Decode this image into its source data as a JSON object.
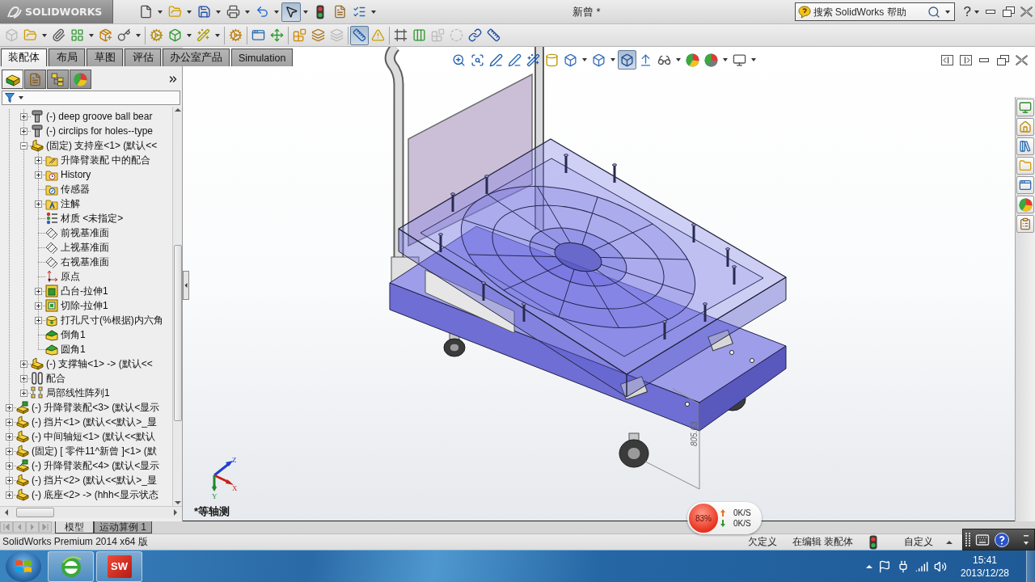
{
  "window": {
    "logo": "SOLIDWORKS",
    "title": "新曾 *",
    "help_button": "?"
  },
  "quick_access": [
    {
      "kind": "new",
      "dropdown": true,
      "pressed": false
    },
    {
      "kind": "open",
      "dropdown": true,
      "pressed": false
    },
    {
      "kind": "save",
      "dropdown": true,
      "pressed": false
    },
    {
      "kind": "print",
      "dropdown": true,
      "pressed": false
    },
    {
      "kind": "undo",
      "dropdown": true,
      "pressed": false
    },
    {
      "kind": "select",
      "dropdown": true,
      "pressed": true
    },
    {
      "kind": "rebuild",
      "dropdown": false,
      "pressed": false
    },
    {
      "kind": "file_properties",
      "dropdown": false,
      "pressed": false
    },
    {
      "kind": "options",
      "dropdown": true,
      "pressed": false
    }
  ],
  "help_search": {
    "placeholder": "搜索 SolidWorks 帮助"
  },
  "command_toolbar": [
    [
      {
        "kind": "edit_component",
        "dropdown": false,
        "pressed": false,
        "disabled": true
      },
      {
        "kind": "insert_components",
        "dropdown": true,
        "pressed": false,
        "disabled": false
      },
      {
        "kind": "mate",
        "dropdown": false,
        "pressed": false,
        "disabled": false
      },
      {
        "kind": "linear_pattern",
        "dropdown": true,
        "pressed": false,
        "disabled": false
      },
      {
        "kind": "smart_fasteners",
        "dropdown": false,
        "pressed": false,
        "disabled": false
      },
      {
        "kind": "move_component",
        "dropdown": true,
        "pressed": false,
        "disabled": false
      }
    ],
    [
      {
        "kind": "show_hidden",
        "dropdown": false,
        "pressed": false,
        "disabled": false
      },
      {
        "kind": "assembly_features",
        "dropdown": true,
        "pressed": false,
        "disabled": false
      },
      {
        "kind": "reference_geometry",
        "dropdown": true,
        "pressed": false,
        "disabled": false
      }
    ],
    [
      {
        "kind": "new_motion_study",
        "dropdown": false,
        "pressed": false,
        "disabled": false
      }
    ],
    [
      {
        "kind": "bill_of_materials",
        "dropdown": false,
        "pressed": false,
        "disabled": false
      },
      {
        "kind": "exploded_view",
        "dropdown": false,
        "pressed": false,
        "disabled": false
      }
    ],
    [
      {
        "kind": "explode_line_sketch",
        "dropdown": false,
        "pressed": false,
        "disabled": false
      },
      {
        "kind": "interference_detection",
        "dropdown": false,
        "pressed": false,
        "disabled": false
      },
      {
        "kind": "clearance_verification",
        "dropdown": false,
        "pressed": false,
        "disabled": true
      }
    ],
    [
      {
        "kind": "hole_alignment",
        "dropdown": false,
        "pressed": true,
        "disabled": false
      },
      {
        "kind": "compare_documents",
        "dropdown": false,
        "pressed": false,
        "disabled": false
      }
    ],
    [
      {
        "kind": "assembly_visualization",
        "dropdown": false,
        "pressed": false,
        "disabled": false
      },
      {
        "kind": "performance_evaluation",
        "dropdown": false,
        "pressed": false,
        "disabled": false
      },
      {
        "kind": "large_assembly_mode",
        "dropdown": false,
        "pressed": false,
        "disabled": true
      },
      {
        "kind": "speedpak",
        "dropdown": false,
        "pressed": false,
        "disabled": true
      },
      {
        "kind": "take_snapshot",
        "dropdown": false,
        "pressed": false,
        "disabled": false
      },
      {
        "kind": "large_design_review",
        "dropdown": false,
        "pressed": false,
        "disabled": false
      }
    ]
  ],
  "command_tabs": [
    {
      "label": "装配体",
      "selected": true
    },
    {
      "label": "布局",
      "selected": false
    },
    {
      "label": "草图",
      "selected": false
    },
    {
      "label": "评估",
      "selected": false
    },
    {
      "label": "办公室产品",
      "selected": false
    },
    {
      "label": "Simulation",
      "selected": false
    }
  ],
  "feature_manager": {
    "panel_tabs": [
      {
        "kind": "feature_tree",
        "selected": true
      },
      {
        "kind": "properties",
        "selected": false
      },
      {
        "kind": "configurations",
        "selected": false
      },
      {
        "kind": "display",
        "selected": false
      }
    ],
    "tree": {
      "continued_children": [
        {
          "label": "(-) deep groove ball bear",
          "kind": "toolbox_part",
          "expanded": false
        },
        {
          "label": "(-) circlips for holes--type",
          "kind": "toolbox_part",
          "expanded": false
        },
        {
          "label": "(固定) 支持座<1> (默认<<",
          "kind": "part",
          "expanded": true,
          "children": [
            {
              "label": "升降臂装配 中的配合",
              "kind": "mates_folder",
              "expanded": false
            },
            {
              "label": "History",
              "kind": "history",
              "expanded": false
            },
            {
              "label": "传感器",
              "kind": "sensors"
            },
            {
              "label": "注解",
              "kind": "annotations",
              "expanded": false
            },
            {
              "label": "材质 <未指定>",
              "kind": "material"
            },
            {
              "label": "前视基准面",
              "kind": "plane"
            },
            {
              "label": "上视基准面",
              "kind": "plane"
            },
            {
              "label": "右视基准面",
              "kind": "plane"
            },
            {
              "label": "原点",
              "kind": "origin"
            },
            {
              "label": "凸台-拉伸1",
              "kind": "boss",
              "expanded": false
            },
            {
              "label": "切除-拉伸1",
              "kind": "cut",
              "expanded": false
            },
            {
              "label": "打孔尺寸(%根据)内六角",
              "kind": "hole",
              "expanded": false
            },
            {
              "label": "倒角1",
              "kind": "chamfer"
            },
            {
              "label": "圆角1",
              "kind": "fillet"
            }
          ]
        },
        {
          "label": "(-) 支撑轴<1> -> (默认<<",
          "kind": "part",
          "expanded": false
        },
        {
          "label": "配合",
          "kind": "mates",
          "expanded": false
        },
        {
          "label": "局部线性阵列1",
          "kind": "pattern",
          "expanded": false
        }
      ],
      "items": [
        {
          "label": "(-) 升降臂装配<3> (默认<显示",
          "kind": "subassembly",
          "expanded": false
        },
        {
          "label": "(-) 挡片<1> (默认<<默认>_显",
          "kind": "part",
          "expanded": false
        },
        {
          "label": "(-) 中间轴短<1> (默认<<默认",
          "kind": "part",
          "expanded": false
        },
        {
          "label": "(固定) [ 零件11^新曾 ]<1> (默",
          "kind": "part",
          "expanded": false
        },
        {
          "label": "(-) 升降臂装配<4> (默认<显示",
          "kind": "subassembly",
          "expanded": false
        },
        {
          "label": "(-) 挡片<2> (默认<<默认>_显",
          "kind": "part",
          "expanded": false
        },
        {
          "label": "(-) 底座<2> -> (hhh<显示状态",
          "kind": "part",
          "expanded": false
        }
      ]
    }
  },
  "graphics_area": {
    "heads_up_toolbar": [
      {
        "kind": "zoom_fit",
        "dropdown": false,
        "pressed": false
      },
      {
        "kind": "zoom_area",
        "dropdown": false,
        "pressed": false
      },
      {
        "kind": "previous_view",
        "dropdown": false,
        "pressed": false
      },
      {
        "kind": "rotate_view",
        "dropdown": false,
        "pressed": false
      },
      {
        "kind": "dynamic_annotation",
        "dropdown": false,
        "pressed": false
      },
      {
        "kind": "section_view",
        "dropdown": false,
        "pressed": false
      },
      {
        "kind": "view_orientation",
        "dropdown": true,
        "pressed": false
      },
      {
        "kind": "display_style",
        "dropdown": true,
        "pressed": false
      },
      {
        "kind": "shaded",
        "dropdown": false,
        "pressed": true
      },
      {
        "kind": "hide_show",
        "dropdown": false,
        "pressed": false
      },
      {
        "kind": "hide_show_items",
        "dropdown": true,
        "pressed": false
      },
      {
        "kind": "edit_appearance",
        "dropdown": false,
        "pressed": false
      },
      {
        "kind": "apply_scene",
        "dropdown": true,
        "pressed": false
      },
      {
        "kind": "view_settings",
        "dropdown": true,
        "pressed": false
      }
    ],
    "dimension": "805.63",
    "view_label": "*等轴测",
    "triad": [
      {
        "kind": "z",
        "label": "Z"
      },
      {
        "kind": "x",
        "label": "X"
      },
      {
        "kind": "y",
        "label": "Y"
      }
    ]
  },
  "task_pane": [
    {
      "kind": "forum"
    },
    {
      "kind": "resources"
    },
    {
      "kind": "design_library"
    },
    {
      "kind": "file_explorer"
    },
    {
      "kind": "view_palette"
    },
    {
      "kind": "appearances"
    },
    {
      "kind": "custom_properties"
    }
  ],
  "bottom_tabs": [
    {
      "label": "模型",
      "selected": true
    },
    {
      "label": "运动算例 1",
      "selected": false
    }
  ],
  "status_bar": {
    "product": "SolidWorks Premium 2014 x64 版",
    "definition": "欠定义",
    "editing": "在编辑 装配体",
    "units": "自定义"
  },
  "network_monitor": {
    "load": "83%",
    "upload": "0K/S",
    "download": "0K/S"
  },
  "taskbar": {
    "apps": [
      {
        "kind": "browser"
      },
      {
        "kind": "solidworks",
        "text": "SW"
      }
    ],
    "time": "15:41",
    "date": "2013/12/28"
  }
}
